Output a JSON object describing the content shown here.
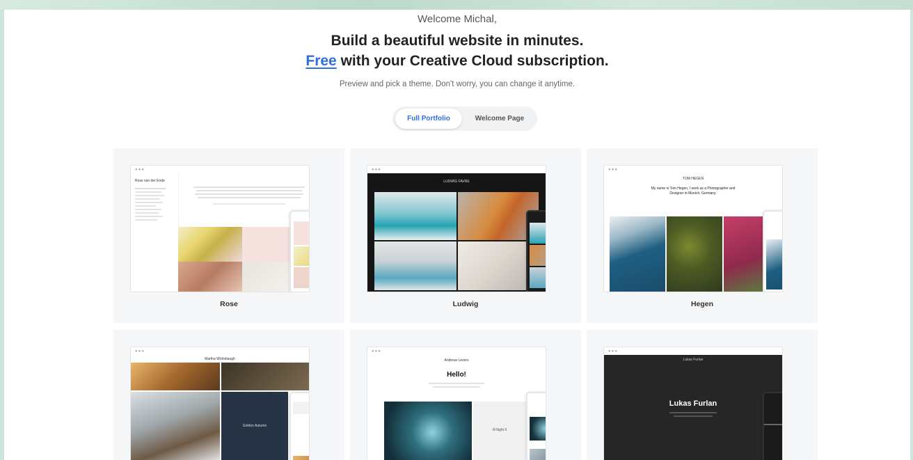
{
  "header": {
    "welcome": "Welcome Michal,",
    "headline_line1": "Build a beautiful website in minutes.",
    "free_word": "Free",
    "headline_line2_rest": " with your Creative Cloud subscription.",
    "subtitle": "Preview and pick a theme. Don't worry, you can change it anytime."
  },
  "toggle": {
    "options": [
      "Full Portfolio",
      "Welcome Page"
    ],
    "selected": "Full Portfolio"
  },
  "themes": [
    {
      "name": "Rose",
      "preview_title": "Rose van der Ende"
    },
    {
      "name": "Ludwig",
      "preview_title": "LUDWIG FAVRE"
    },
    {
      "name": "Hegen",
      "preview_title": "TOM HEGEN",
      "preview_text": "My name is Tom Hegen, I work as a Photographer and Designer in Munich, Germany."
    },
    {
      "name": "",
      "preview_title": "Martha Wörlsbaugh",
      "preview_caption": "Golden Autumn"
    },
    {
      "name": "",
      "preview_title": "Andreas Levers",
      "preview_heading": "Hello!",
      "preview_caption": "A Night II"
    },
    {
      "name": "",
      "preview_title": "Lukas Furlan",
      "preview_heading": "Lukas Furlan"
    }
  ],
  "colors": {
    "accent": "#2d6fe0",
    "card_bg": "#f5f6f8",
    "page_bg": "#ffffff"
  }
}
